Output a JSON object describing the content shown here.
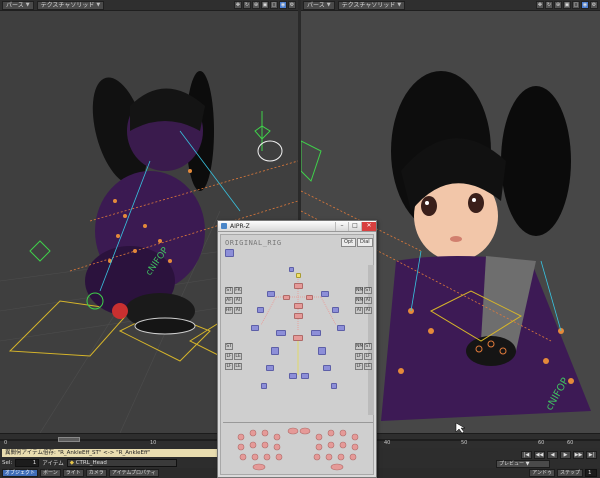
{
  "left_viewport": {
    "view_mode": "パース",
    "render_mode": "テクスチャソリッド",
    "icons": [
      "move-icon",
      "rotate-icon",
      "zoom-icon",
      "fit-icon",
      "maximize-icon",
      "camera-icon",
      "settings-icon"
    ]
  },
  "right_viewport": {
    "view_mode": "パース",
    "render_mode": "テクスチャソリッド",
    "icons": [
      "move-icon",
      "rotate-icon",
      "zoom-icon",
      "fit-icon",
      "maximize-icon",
      "camera-icon",
      "settings-icon"
    ]
  },
  "timeline": {
    "ticks": [
      "0",
      "10",
      "40",
      "50",
      "60",
      "60"
    ]
  },
  "status": {
    "message": "異間何アイテム倍存: \"R_AnkleEff_ST\" <-> \"R_AnkleEff\"",
    "sel_label": "Sel:",
    "sel_value": "1",
    "item_label": "アイテム",
    "current_item": "CTRL_Head",
    "bottom_buttons": [
      "オブジェクト",
      "ボーン",
      "ライト",
      "カメラ",
      "アイテムプロパティ"
    ],
    "preview_label": "プレビュー",
    "step_buttons": [
      "アンドゥ",
      "ステップ",
      "1"
    ]
  },
  "panel": {
    "title": "AIPR-Z",
    "rig_label": "ORIGINAL_RIG",
    "opt_label": "Opt",
    "dial_label": "Dial",
    "left_tags": [
      "ST",
      "AF",
      "HF",
      "ST",
      "LF",
      "LF"
    ],
    "left_tags2": [
      "FK",
      "AI",
      "AI",
      "",
      "LE",
      "LE"
    ],
    "right_tags": [
      "NM",
      "NM",
      "AI",
      "NM",
      "LF",
      "LF"
    ],
    "right_tags2": [
      "ST",
      "AI",
      "AI",
      "ST",
      "LF",
      "LE"
    ]
  },
  "colors": {
    "panel_bg": "#cfcfcf",
    "node_blue": "#8d8fd8",
    "node_red": "#e59a98",
    "node_yellow": "#f1e16a",
    "status_bg": "#e9ddb0"
  }
}
